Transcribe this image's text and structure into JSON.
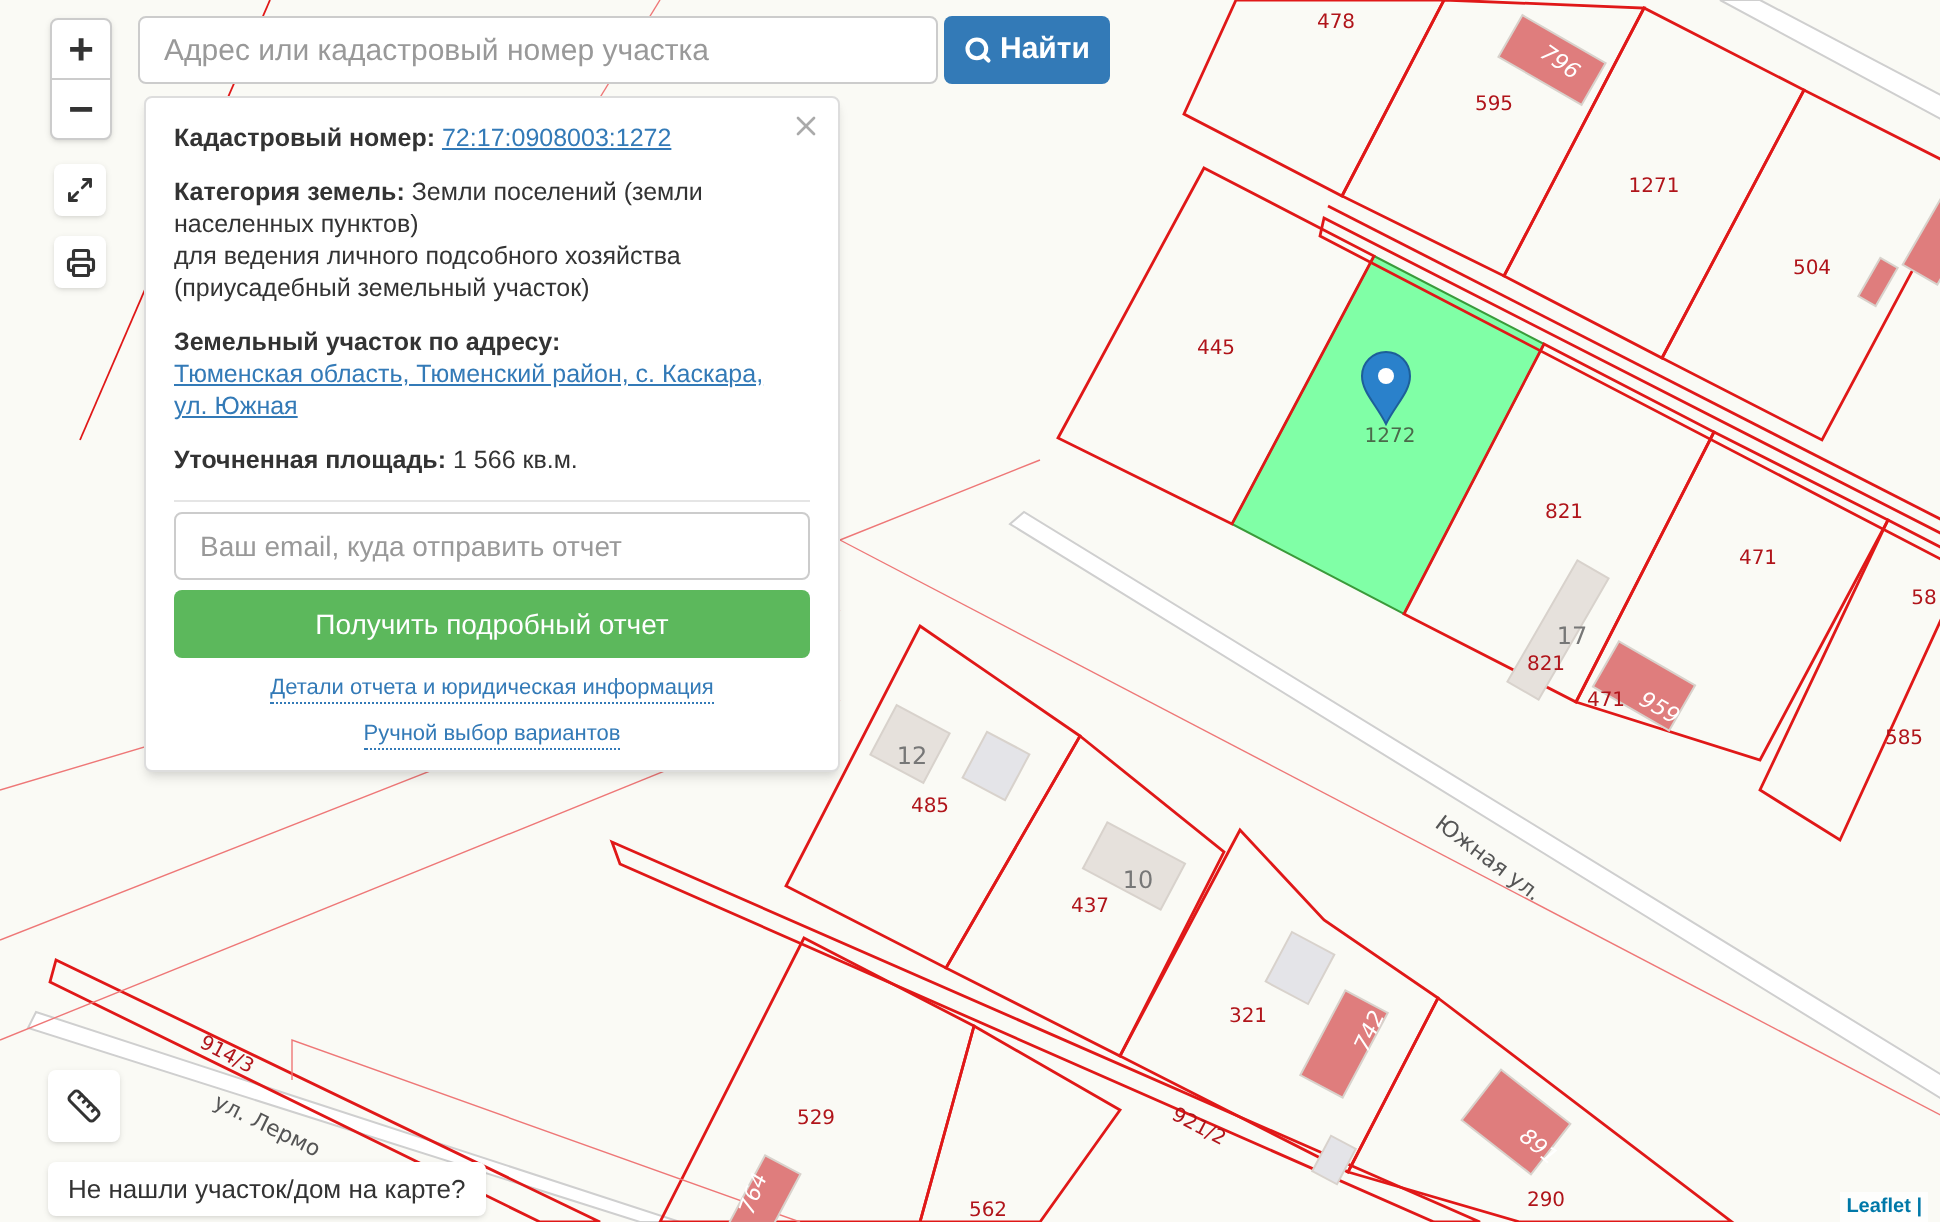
{
  "search": {
    "placeholder": "Адрес или кадастровый номер участка",
    "button": "Найти"
  },
  "zoom": {
    "in": "+",
    "out": "−"
  },
  "popup": {
    "fields": [
      {
        "label": "Кадастровый номер:",
        "kind": "link",
        "lines": [
          "72:17:0908003:1272"
        ]
      },
      {
        "label": "Категория земель:",
        "kind": "text",
        "lines": [
          "Земли поселений (земли населенных пунктов)",
          "для ведения личного подсобного хозяйства (приусадебный земельный участок)"
        ]
      },
      {
        "label": "Земельный участок по адресу:",
        "kind": "link",
        "lines": [
          "Тюменская область, Тюменский район, с. Каскара, ул. Южная"
        ]
      },
      {
        "label": "Уточненная площадь:",
        "kind": "text",
        "lines": [
          "1 566 кв.м."
        ]
      }
    ],
    "email_placeholder": "Ваш email, куда отправить отчет",
    "submit": "Получить подробный отчет",
    "links": [
      "Детали отчета и юридическая информация",
      "Ручной выбор вариантов"
    ]
  },
  "not_found_button": "Не нашли участок/дом на карте?",
  "attribution": "Leaflet |",
  "map": {
    "labels": [
      {
        "kind": "parcel",
        "text": "478"
      },
      {
        "kind": "parcel",
        "text": "595"
      },
      {
        "kind": "building",
        "text": "796"
      },
      {
        "kind": "parcel",
        "text": "1271"
      },
      {
        "kind": "parcel",
        "text": "504"
      },
      {
        "kind": "parcel",
        "text": "445"
      },
      {
        "kind": "selected",
        "text": "1272"
      },
      {
        "kind": "parcel",
        "text": "821"
      },
      {
        "kind": "parcel",
        "text": "471"
      },
      {
        "kind": "parcel",
        "text": "58"
      },
      {
        "kind": "house",
        "text": "17"
      },
      {
        "kind": "parcel",
        "text": "821"
      },
      {
        "kind": "parcel",
        "text": "471"
      },
      {
        "kind": "building",
        "text": "959"
      },
      {
        "kind": "parcel",
        "text": "585"
      },
      {
        "kind": "house",
        "text": "12"
      },
      {
        "kind": "parcel",
        "text": "485"
      },
      {
        "kind": "house",
        "text": "10"
      },
      {
        "kind": "parcel",
        "text": "437"
      },
      {
        "kind": "street",
        "text": "Южная ул."
      },
      {
        "kind": "parcel",
        "text": "321"
      },
      {
        "kind": "building",
        "text": "742"
      },
      {
        "kind": "building",
        "text": "891"
      },
      {
        "kind": "parcel",
        "text": "290"
      },
      {
        "kind": "parcel",
        "text": "914/3"
      },
      {
        "kind": "parcel",
        "text": "921/2"
      },
      {
        "kind": "parcel",
        "text": "529"
      },
      {
        "kind": "parcel",
        "text": "562"
      },
      {
        "kind": "building",
        "text": "764"
      },
      {
        "kind": "street",
        "text": "ул. Лермо"
      }
    ]
  }
}
